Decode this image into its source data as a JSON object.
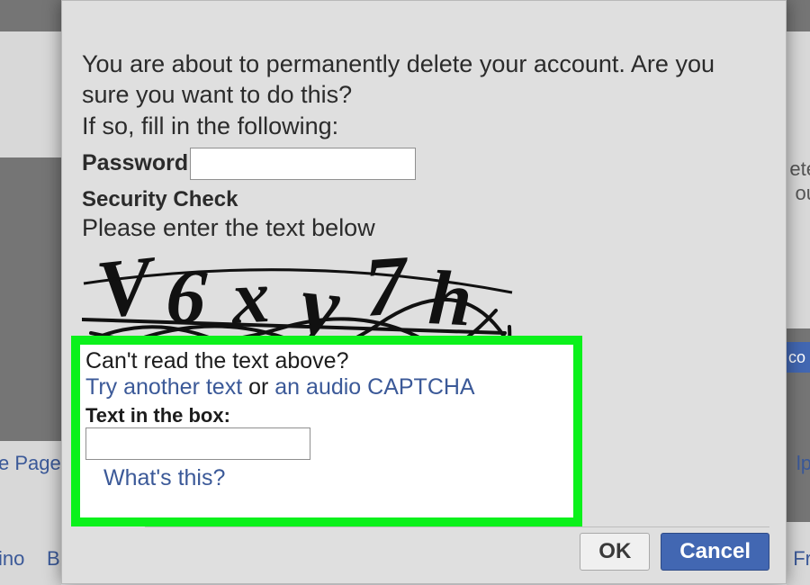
{
  "bg": {
    "left_link_page": "e Page",
    "left_link_bino": "ino",
    "left_link_b": "B",
    "right_text_1": "ete",
    "right_text_2": "ou",
    "right_blue_btn": "co",
    "right_link_lp": "lp",
    "right_link_fr": "Fr"
  },
  "modal": {
    "warning_line_1": "You are about to permanently delete your account. Are you sure you want to do this?",
    "fill_in": "If so, fill in the following:",
    "password_label": "Password",
    "password_value": "",
    "security_check_label": "Security Check",
    "security_instruction": "Please enter the text below",
    "captcha_value": "V6xy7h",
    "cant_read": "Can't read the text above?",
    "try_prefix": "Try another text",
    "try_or": " or ",
    "try_audio": "an audio CAPTCHA",
    "text_in_box_label": "Text in the box:",
    "captcha_input_value": "",
    "whats_this": "What's this?",
    "ok": "OK",
    "cancel": "Cancel"
  }
}
